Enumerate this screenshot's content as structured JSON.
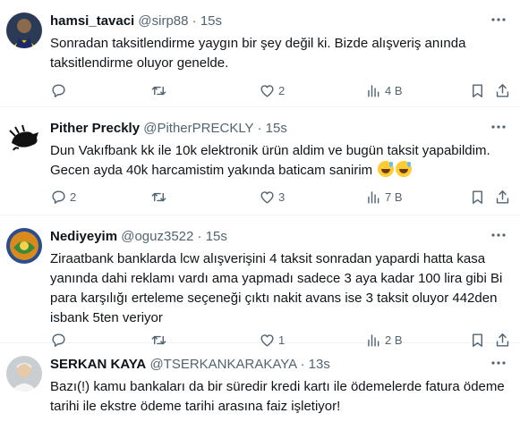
{
  "tweets": [
    {
      "name": "hamsi_tavaci",
      "handle": "@sirp88",
      "dot": "·",
      "time": "15s",
      "text": "Sonradan taksitlendirme yaygın bir şey değil ki. Bizde alışveriş anında taksitlendirme oluyor genelde.",
      "replies": "",
      "retweets": "",
      "likes": "2",
      "views": "4 B"
    },
    {
      "name": "Pither Preckly",
      "handle": "@PitherPRECKLY",
      "dot": "·",
      "time": "15s",
      "text": "Dun Vakıfbank kk ile 10k elektronik ürün aldim ve bugün taksit yapabildim. Gecen ayda 40k harcamistim yakında baticam sanirim",
      "emojis": [
        "sweat-smile-emoji",
        "sweat-smile-emoji"
      ],
      "replies": "2",
      "retweets": "",
      "likes": "3",
      "views": "7 B"
    },
    {
      "name": "Nediyeyim",
      "handle": "@oguz3522",
      "dot": "·",
      "time": "15s",
      "text": "Ziraatbank banklarda lcw alışverişini 4 taksit sonradan yapardi hatta kasa yanında dahi reklamı vardı ama yapmadı sadece 3 aya kadar 100 lira gibi Bi para karşılığı erteleme seçeneği çıktı nakit avans ise 3 taksit oluyor 442den isbank 5ten veriyor",
      "replies": "",
      "retweets": "",
      "likes": "1",
      "views": "2 B"
    },
    {
      "name": "SERKAN KAYA",
      "handle": "@TSERKANKARAKAYA",
      "dot": "·",
      "time": "13s",
      "text": "Bazı(!) kamu bankaları da bir süredir kredi kartı ile ödemelerde fatura ödeme tarihi ile ekstre ödeme tarihi arasına faiz işletiyor!"
    }
  ],
  "icons": {
    "more": "more-horizontal-icon",
    "reply": "reply-icon",
    "retweet": "retweet-icon",
    "like": "like-icon",
    "views": "views-icon",
    "bookmark": "bookmark-icon",
    "share": "share-icon"
  },
  "colors": {
    "text": "#0f1419",
    "secondary": "#536471",
    "divider": "#eff3f4"
  }
}
